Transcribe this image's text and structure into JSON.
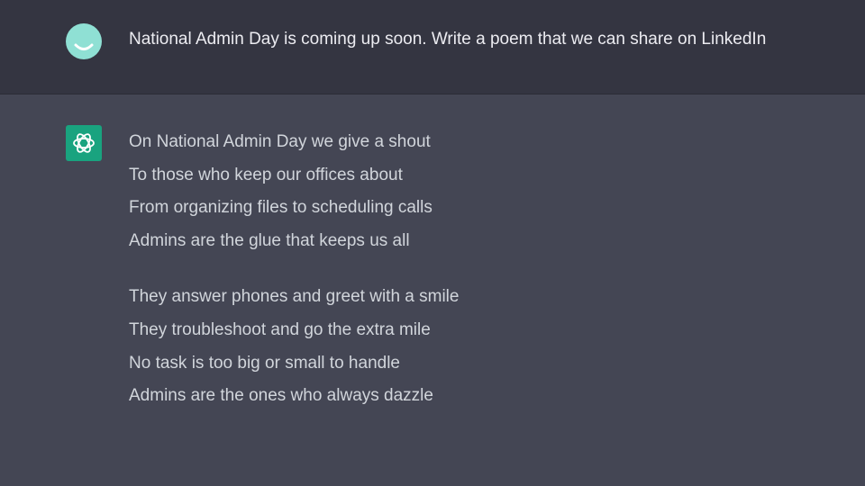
{
  "conversation": {
    "user_message": "National Admin Day is coming up soon. Write a poem that we can share on LinkedIn",
    "assistant_poem": {
      "stanzas": [
        [
          "On National Admin Day we give a shout",
          "To those who keep our offices about",
          "From organizing files to scheduling calls",
          "Admins are the glue that keeps us all"
        ],
        [
          "They answer phones and greet with a smile",
          "They troubleshoot and go the extra mile",
          "No task is too big or small to handle",
          "Admins are the ones who always dazzle"
        ]
      ]
    }
  },
  "icons": {
    "user_avatar": "smiley-avatar-icon",
    "assistant_avatar": "openai-logo-icon"
  },
  "colors": {
    "user_row_bg": "#343541",
    "assistant_row_bg": "#444654",
    "user_avatar_bg": "#8fe0d4",
    "assistant_avatar_bg": "#19a37f",
    "text": "#ececf1"
  }
}
